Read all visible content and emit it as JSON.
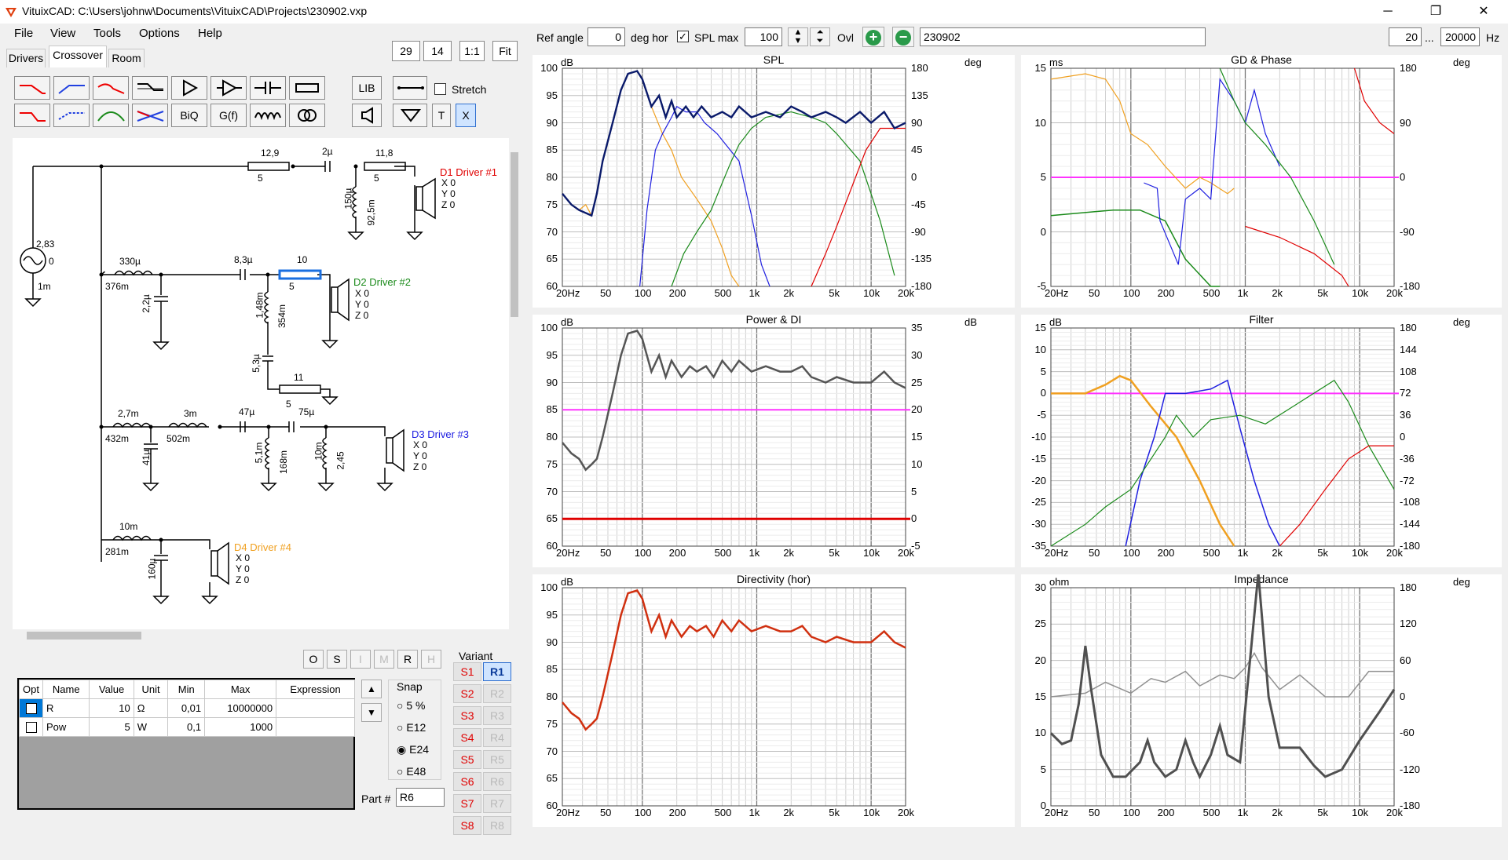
{
  "app": {
    "title": "VituixCAD: C:\\Users\\johnw\\Documents\\VituixCAD\\Projects\\230902.vxp",
    "minimize": "─",
    "maximize": "❐",
    "close": "✕"
  },
  "menu": [
    "File",
    "View",
    "Tools",
    "Options",
    "Help"
  ],
  "tabs": [
    "Drivers",
    "Crossover",
    "Room"
  ],
  "zoom": {
    "v1": "29",
    "v2": "14",
    "one": "1:1",
    "fit": "Fit"
  },
  "toolbar": {
    "lib": "LIB",
    "biq": "BiQ",
    "gf": "G(f)",
    "t": "T",
    "x": "X",
    "stretch": "Stretch"
  },
  "topbar": {
    "ref_angle_label": "Ref angle",
    "ref_angle": "0",
    "deg_hor": "deg hor",
    "spl_max_label": "SPL max",
    "spl_max": "100",
    "ovl_label": "Ovl",
    "ovl_value": "230902",
    "f_min": "20",
    "f_sep": "...",
    "f_max": "20000",
    "hz": "Hz"
  },
  "schematic": {
    "d1": {
      "name": "D1 Driver #1",
      "color": "#e00000"
    },
    "d2": {
      "name": "D2 Driver #2",
      "color": "#1a8a1a"
    },
    "d3": {
      "name": "D3 Driver #3",
      "color": "#1a1ae0"
    },
    "d4": {
      "name": "D4 Driver #4",
      "color": "#f0a020"
    },
    "xyz": [
      "X 0",
      "Y 0",
      "Z 0"
    ],
    "labels": [
      "12,9",
      "5",
      "2µ",
      "11,8",
      "5",
      "150µ",
      "92,5m",
      "2,83",
      "0",
      "1m",
      "330µ",
      "376m",
      "2,2µ",
      "8,3µ",
      "10",
      "5",
      "1,48m",
      "354m",
      "5,3µ",
      "11",
      "5",
      "2,7m",
      "432m",
      "3m",
      "502m",
      "41µ",
      "47µ",
      "75µ",
      "5,1m",
      "168m",
      "10m",
      "2,45",
      "10m",
      "281m",
      "160µ"
    ]
  },
  "opt_buttons": [
    "O",
    "S",
    "I",
    "M",
    "R",
    "H"
  ],
  "table": {
    "headers": [
      "Opt",
      "Name",
      "Value",
      "Unit",
      "Min",
      "Max",
      "Expression"
    ],
    "rows": [
      [
        "",
        "R",
        "10",
        "Ω",
        "0,01",
        "10000000",
        ""
      ],
      [
        "",
        "Pow",
        "5",
        "W",
        "0,1",
        "1000",
        ""
      ]
    ]
  },
  "snap": {
    "label": "Snap",
    "options": [
      "5 %",
      "E12",
      "E24",
      "E48"
    ],
    "selected": "E24"
  },
  "part": {
    "label": "Part #",
    "value": "R6"
  },
  "variant": {
    "label": "Variant",
    "s": [
      "S1",
      "S2",
      "S3",
      "S4",
      "S5",
      "S6",
      "S7",
      "S8"
    ],
    "r": [
      "R1",
      "R2",
      "R3",
      "R4",
      "R5",
      "R6",
      "R7",
      "R8"
    ],
    "active": "R1"
  },
  "freq_ticks": [
    "20Hz",
    "50",
    "100",
    "200",
    "500",
    "1k",
    "2k",
    "5k",
    "10k",
    "20k"
  ],
  "charts": {
    "spl": {
      "title": "SPL",
      "lunit": "dB",
      "runit": "deg",
      "left": [
        "100",
        "95",
        "90",
        "85",
        "80",
        "75",
        "70",
        "65",
        "60"
      ],
      "right": [
        "180",
        "135",
        "90",
        "45",
        "0",
        "-45",
        "-90",
        "-135",
        "-180"
      ]
    },
    "gd": {
      "title": "GD & Phase",
      "lunit": "ms",
      "runit": "deg",
      "left": [
        "15",
        "10",
        "5",
        "0",
        "-5"
      ],
      "right": [
        "180",
        "90",
        "0",
        "-90",
        "-180"
      ]
    },
    "power": {
      "title": "Power & DI",
      "lunit": "dB",
      "runit": "dB",
      "left": [
        "100",
        "95",
        "90",
        "85",
        "80",
        "75",
        "70",
        "65",
        "60"
      ],
      "right": [
        "35",
        "30",
        "25",
        "20",
        "15",
        "10",
        "5",
        "0",
        "-5"
      ]
    },
    "filter": {
      "title": "Filter",
      "lunit": "dB",
      "runit": "deg",
      "left": [
        "15",
        "10",
        "5",
        "0",
        "-5",
        "-10",
        "-15",
        "-20",
        "-25",
        "-30",
        "-35"
      ],
      "right": [
        "180",
        "144",
        "108",
        "72",
        "36",
        "0",
        "-36",
        "-72",
        "-108",
        "-144",
        "-180"
      ]
    },
    "dir": {
      "title": "Directivity (hor)",
      "lunit": "dB",
      "runit": "",
      "left": [
        "100",
        "95",
        "90",
        "85",
        "80",
        "75",
        "70",
        "65",
        "60"
      ],
      "right": []
    },
    "imp": {
      "title": "Impedance",
      "lunit": "ohm",
      "runit": "deg",
      "left": [
        "30",
        "25",
        "20",
        "15",
        "10",
        "5",
        "0"
      ],
      "right": [
        "180",
        "120",
        "60",
        "0",
        "-60",
        "-120",
        "-180"
      ]
    }
  },
  "colors": {
    "woofer": "#f0a020",
    "mid": "#1a8a1a",
    "tweeter": "#e00000",
    "midbass": "#2020e0",
    "total": "#0a1a6a",
    "di": "#ff33ff",
    "red": "#e00000",
    "gray": "#555"
  }
}
